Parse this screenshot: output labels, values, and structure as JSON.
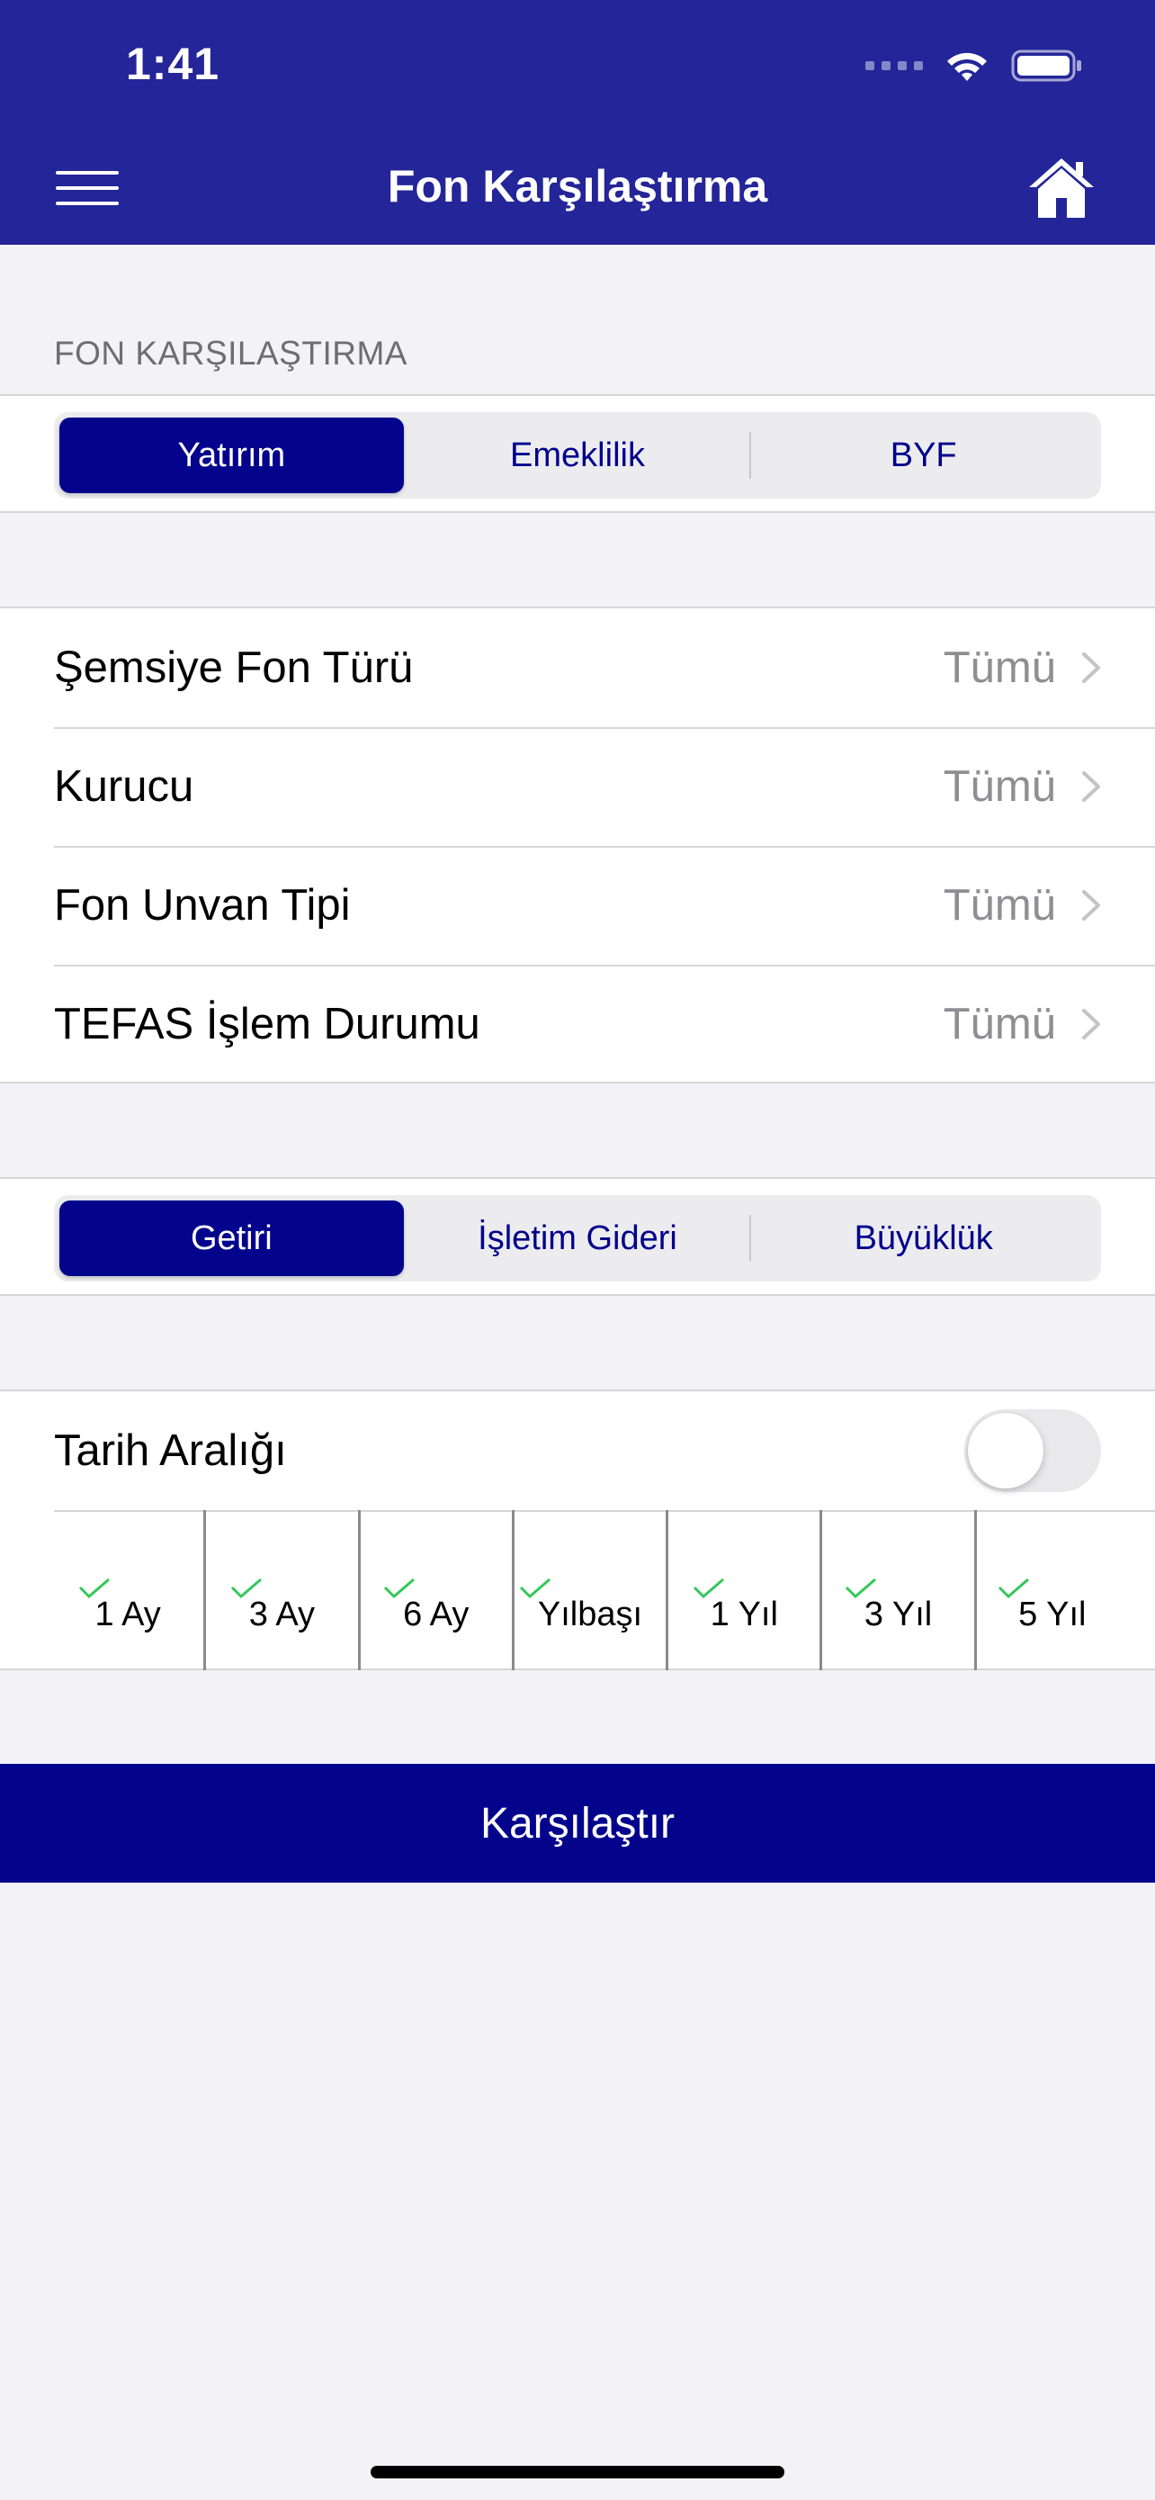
{
  "status_bar": {
    "time": "1:41"
  },
  "nav": {
    "title": "Fon Karşılaştırma"
  },
  "fund_section": {
    "header": "FON KARŞILAŞTIRMA",
    "segments": [
      "Yatırım",
      "Emeklilik",
      "BYF"
    ],
    "selected": "Yatırım"
  },
  "filters": [
    {
      "label": "Şemsiye Fon Türü",
      "value": "Tümü"
    },
    {
      "label": "Kurucu",
      "value": "Tümü"
    },
    {
      "label": "Fon Unvan Tipi",
      "value": "Tümü"
    },
    {
      "label": "TEFAS İşlem Durumu",
      "value": "Tümü"
    }
  ],
  "metric_section": {
    "segments": [
      "Getiri",
      "İşletim Gideri",
      "Büyüklük"
    ],
    "selected": "Getiri"
  },
  "date_range": {
    "label": "Tarih Aralığı",
    "toggle_on": false,
    "periods": [
      "1 Ay",
      "3 Ay",
      "6 Ay",
      "Yılbaşı",
      "1 Yıl",
      "3 Yıl",
      "5 Yıl"
    ]
  },
  "compare_button": {
    "label": "Karşılaştır"
  },
  "colors": {
    "nav_bar": "#232598",
    "accent": "#03038c",
    "check": "#34c759",
    "background": "#f2f2f7"
  }
}
